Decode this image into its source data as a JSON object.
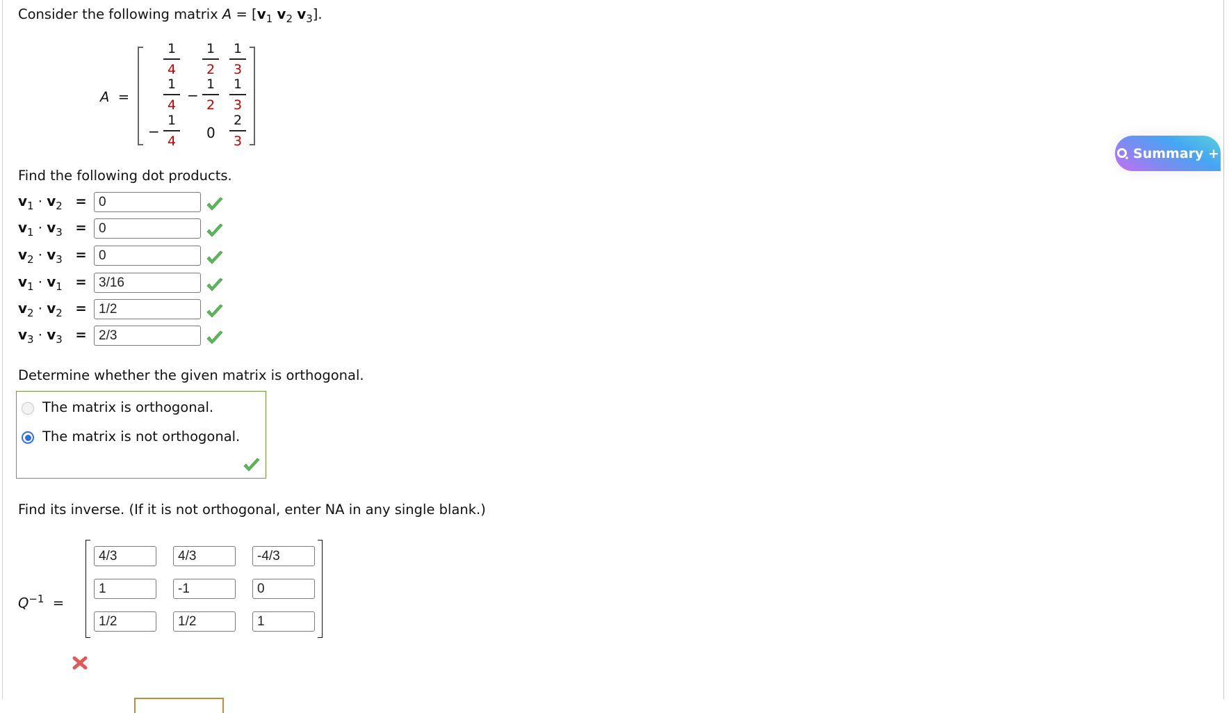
{
  "intro": {
    "text": "Consider the following matrix ",
    "A": "A",
    "eq": " = [",
    "v": "v",
    "s1": "1",
    "s2": "2",
    "s3": "3",
    "close": "]."
  },
  "matrix_A": {
    "label": "A",
    "eq": "=",
    "cells": [
      [
        {
          "sign": "",
          "num": "1",
          "den": "4"
        },
        {
          "sign": "",
          "num": "1",
          "den": "2"
        },
        {
          "sign": "",
          "num": "1",
          "den": "3"
        }
      ],
      [
        {
          "sign": "",
          "num": "1",
          "den": "4"
        },
        {
          "sign": "−",
          "num": "1",
          "den": "2"
        },
        {
          "sign": "",
          "num": "1",
          "den": "3"
        }
      ],
      [
        {
          "sign": "−",
          "num": "1",
          "den": "4"
        },
        {
          "sign": "",
          "value": "0"
        },
        {
          "sign": "",
          "num": "2",
          "den": "3"
        }
      ]
    ]
  },
  "dot_products": {
    "heading": "Find the following dot products.",
    "rows": [
      {
        "a": "1",
        "b": "2",
        "value": "0",
        "status": "correct"
      },
      {
        "a": "1",
        "b": "3",
        "value": "0",
        "status": "correct"
      },
      {
        "a": "2",
        "b": "3",
        "value": "0",
        "status": "correct"
      },
      {
        "a": "1",
        "b": "1",
        "value": "3/16",
        "status": "correct"
      },
      {
        "a": "2",
        "b": "2",
        "value": "1/2",
        "status": "correct"
      },
      {
        "a": "3",
        "b": "3",
        "value": "2/3",
        "status": "correct"
      }
    ],
    "v": "v",
    "dot": "·",
    "eq": "="
  },
  "orthogonal": {
    "heading": "Determine whether the given matrix is orthogonal.",
    "options": [
      {
        "label": "The matrix is orthogonal.",
        "selected": false
      },
      {
        "label": "The matrix is not orthogonal.",
        "selected": true
      }
    ],
    "status": "correct"
  },
  "inverse": {
    "heading": "Find its inverse. (If it is not orthogonal, enter NA in any single blank.)",
    "label": "Q",
    "sup": "−1",
    "eq": "=",
    "cells": [
      [
        "4/3",
        "4/3",
        "-4/3"
      ],
      [
        "1",
        "-1",
        "0"
      ],
      [
        "1/2",
        "1/2",
        "1"
      ]
    ],
    "status": "incorrect"
  },
  "summary_button": {
    "label": "Summary +",
    "icon": "search-icon"
  },
  "colors": {
    "correct": "#5cb85c",
    "incorrect": "#e05a5a",
    "denominator": "#c00000",
    "radio_selected": "#2f6fe0",
    "box_border": "#6c9a38"
  }
}
